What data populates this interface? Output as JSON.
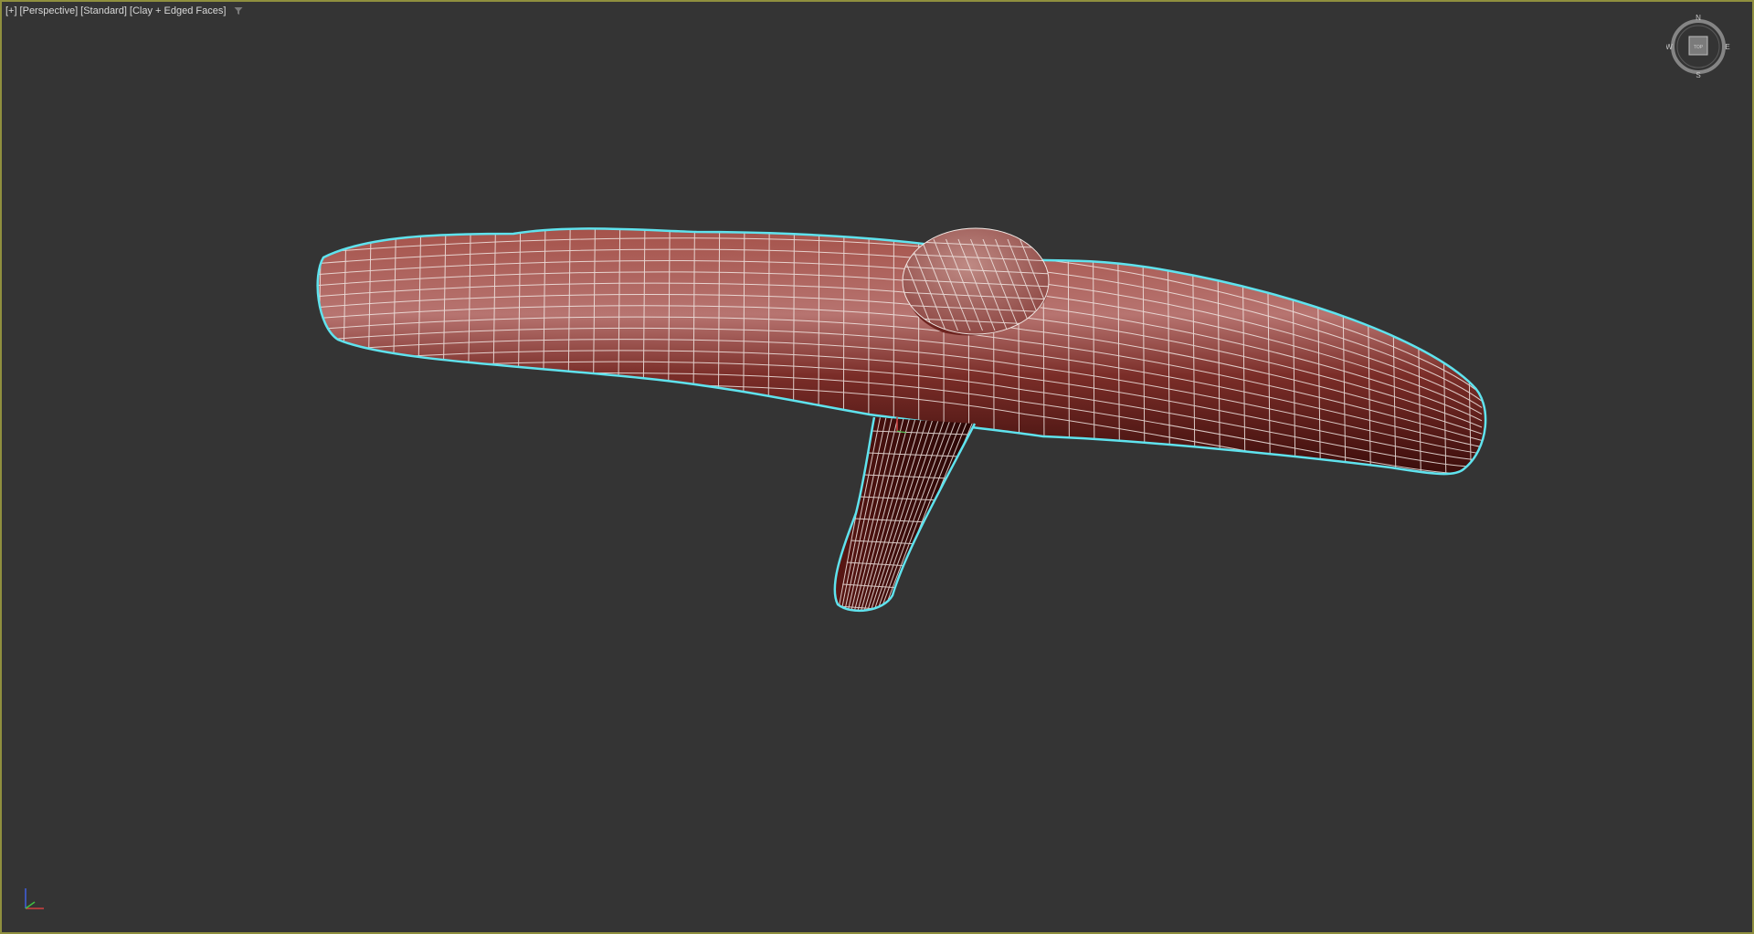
{
  "viewport": {
    "label_menu": "[+]",
    "label_view": "[Perspective]",
    "label_shading_preset": "[Standard]",
    "label_display_mode": "[Clay + Edged Faces]",
    "filter_icon": "funnel-icon"
  },
  "viewcube": {
    "face_label": "TOP",
    "north": "N",
    "south": "S",
    "east": "E",
    "west": "W"
  },
  "colors": {
    "background": "#343434",
    "viewport_border": "#8f8f3e",
    "selection_outline": "#5fe3ee",
    "clay_base": "#8c3a34",
    "clay_highlight": "#c8847e",
    "wire": "#f2e8e4"
  },
  "axis_tripod": {
    "x_color": "#d04040",
    "y_color": "#40c040",
    "z_color": "#4060e0"
  }
}
